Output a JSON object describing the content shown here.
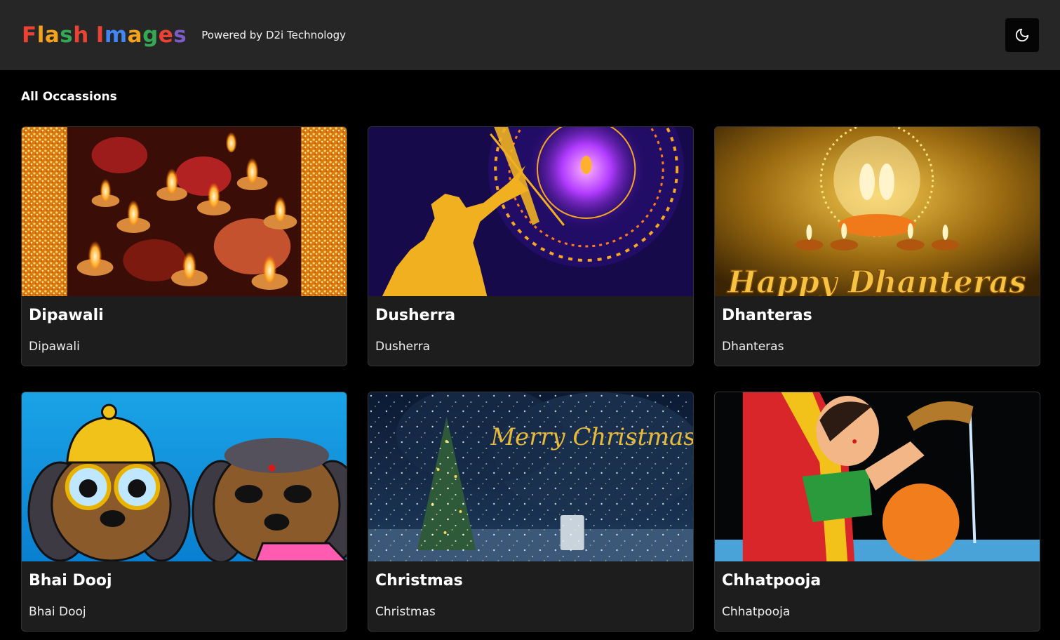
{
  "header": {
    "logo_letters": [
      {
        "ch": "F",
        "color": "#ea4335"
      },
      {
        "ch": "l",
        "color": "#f4a21b"
      },
      {
        "ch": "a",
        "color": "#f4a21b"
      },
      {
        "ch": "s",
        "color": "#34a853"
      },
      {
        "ch": "h",
        "color": "#ea4335"
      },
      {
        "ch": " ",
        "color": "#ffffff"
      },
      {
        "ch": "I",
        "color": "#ea4335"
      },
      {
        "ch": "m",
        "color": "#4285f4"
      },
      {
        "ch": "a",
        "color": "#f4a21b"
      },
      {
        "ch": "g",
        "color": "#34a853"
      },
      {
        "ch": "e",
        "color": "#ea4335"
      },
      {
        "ch": "s",
        "color": "#7b5cc4"
      }
    ],
    "tagline": "Powered by D2i Technology",
    "theme_icon": "moon-icon"
  },
  "section": {
    "title": "All Occassions"
  },
  "cards": [
    {
      "title": "Dipawali",
      "subtitle": "Dipawali",
      "image": "diyas-candles"
    },
    {
      "title": "Dusherra",
      "subtitle": "Dusherra",
      "image": "archer-mandala"
    },
    {
      "title": "Dhanteras",
      "subtitle": "Dhanteras",
      "image": "happy-dhanteras"
    },
    {
      "title": "Bhai Dooj",
      "subtitle": "Bhai Dooj",
      "image": "cartoon-dogs"
    },
    {
      "title": "Christmas",
      "subtitle": "Christmas",
      "image": "merry-christmas-tree"
    },
    {
      "title": "Chhatpooja",
      "subtitle": "Chhatpooja",
      "image": "woman-offering-sun"
    }
  ]
}
